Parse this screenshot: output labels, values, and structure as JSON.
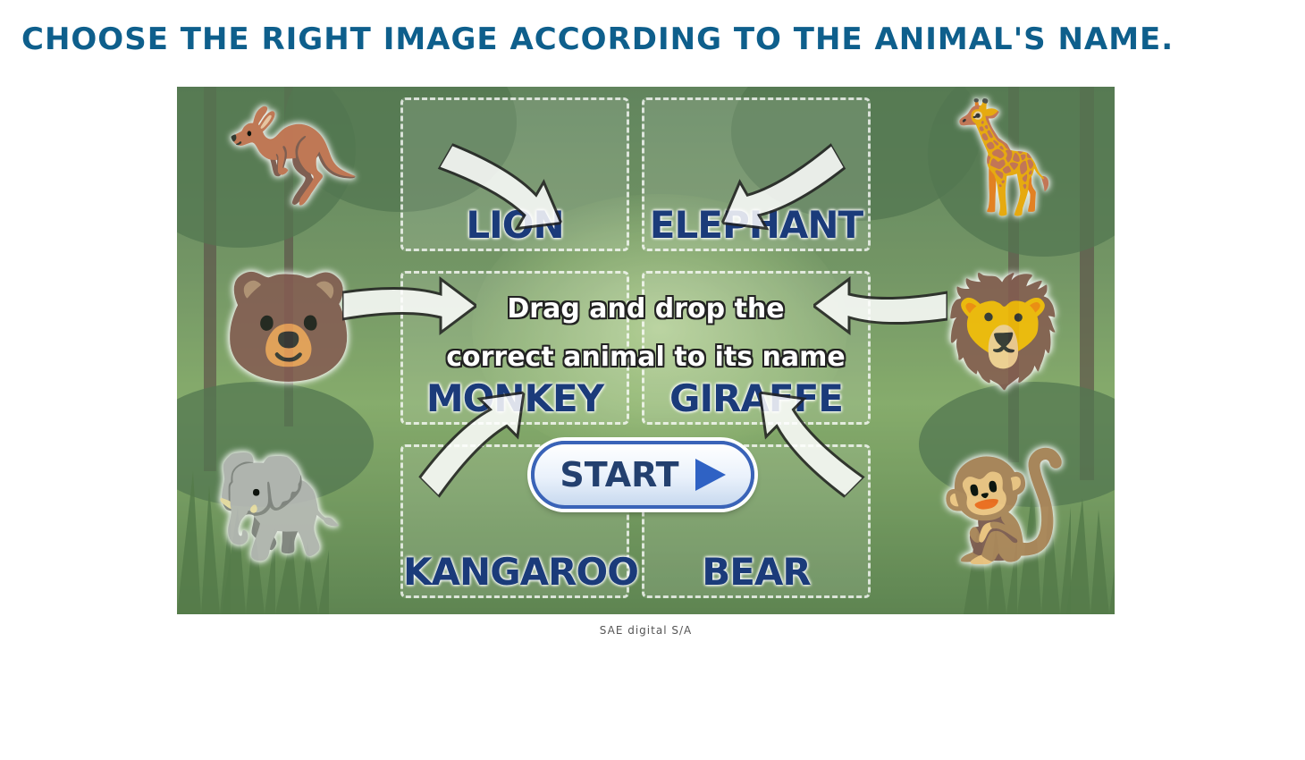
{
  "header": {
    "title": "CHOOSE THE RIGHT IMAGE ACCORDING TO THE ANIMAL'S NAME."
  },
  "game": {
    "instruction_line1": "Drag and drop the",
    "instruction_line2": "correct animal to its name",
    "start_label": "START",
    "slots": [
      {
        "label": "LION"
      },
      {
        "label": "ELEPHANT"
      },
      {
        "label": "MONKEY"
      },
      {
        "label": "GIRAFFE"
      },
      {
        "label": "KANGAROO"
      },
      {
        "label": "BEAR"
      }
    ],
    "animals_left": [
      {
        "icon": "kangaroo-icon",
        "glyph": "🦘"
      },
      {
        "icon": "bear-icon",
        "glyph": "🐻"
      },
      {
        "icon": "elephant-icon",
        "glyph": "🐘"
      }
    ],
    "animals_right": [
      {
        "icon": "giraffe-icon",
        "glyph": "🦒"
      },
      {
        "icon": "lion-icon",
        "glyph": "🦁"
      },
      {
        "icon": "monkey-icon",
        "glyph": "🐒"
      }
    ]
  },
  "footer": {
    "caption": "SAE digital S/A"
  },
  "colors": {
    "title": "#0e5f8c",
    "slot_label": "#1b3b7a",
    "start_border": "#3a63b8",
    "play_icon": "#2f62c4"
  }
}
